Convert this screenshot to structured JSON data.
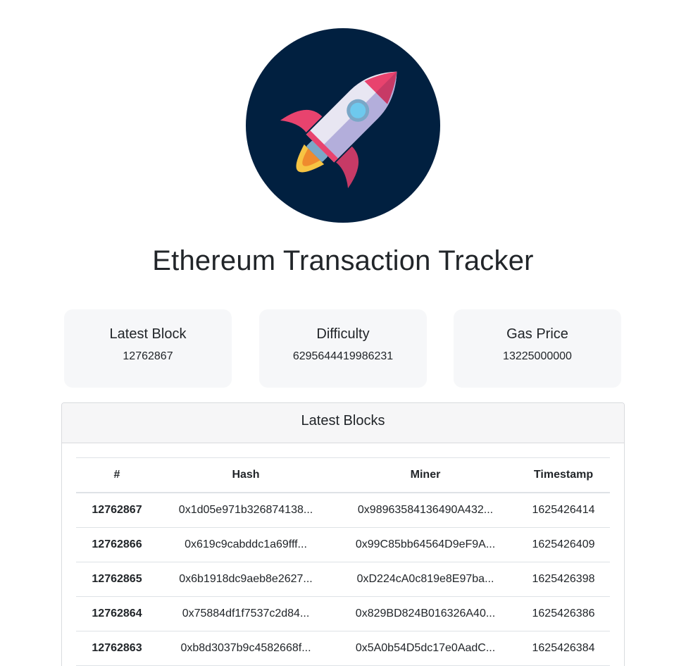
{
  "header": {
    "logo": "rocket-logo",
    "title": "Ethereum Transaction Tracker"
  },
  "stats": {
    "latest_block": {
      "label": "Latest Block",
      "value": "12762867"
    },
    "difficulty": {
      "label": "Difficulty",
      "value": "6295644419986231"
    },
    "gas_price": {
      "label": "Gas Price",
      "value": "13225000000"
    }
  },
  "blocks": {
    "title": "Latest Blocks",
    "columns": [
      "#",
      "Hash",
      "Miner",
      "Timestamp"
    ],
    "rows": [
      {
        "number": "12762867",
        "hash": "0x1d05e971b326874138...",
        "miner": "0x98963584136490A432...",
        "timestamp": "1625426414"
      },
      {
        "number": "12762866",
        "hash": "0x619c9cabddc1a69fff...",
        "miner": "0x99C85bb64564D9eF9A...",
        "timestamp": "1625426409"
      },
      {
        "number": "12762865",
        "hash": "0x6b1918dc9aeb8e2627...",
        "miner": "0xD224cA0c819e8E97ba...",
        "timestamp": "1625426398"
      },
      {
        "number": "12762864",
        "hash": "0x75884df1f7537c2d84...",
        "miner": "0x829BD824B016326A40...",
        "timestamp": "1625426386"
      },
      {
        "number": "12762863",
        "hash": "0xb8d3037b9c4582668f...",
        "miner": "0x5A0b54D5dc17e0AadC...",
        "timestamp": "1625426384"
      }
    ]
  },
  "colors": {
    "logo_bg": "#012040",
    "rocket_body": "#e8e6f2",
    "rocket_shade": "#b3aedb",
    "rocket_accent": "#e8436e",
    "window": "#6ec9ee",
    "flame_outer": "#f7c443",
    "flame_inner": "#ef8a2e",
    "card_bg": "#f6f7f9"
  }
}
